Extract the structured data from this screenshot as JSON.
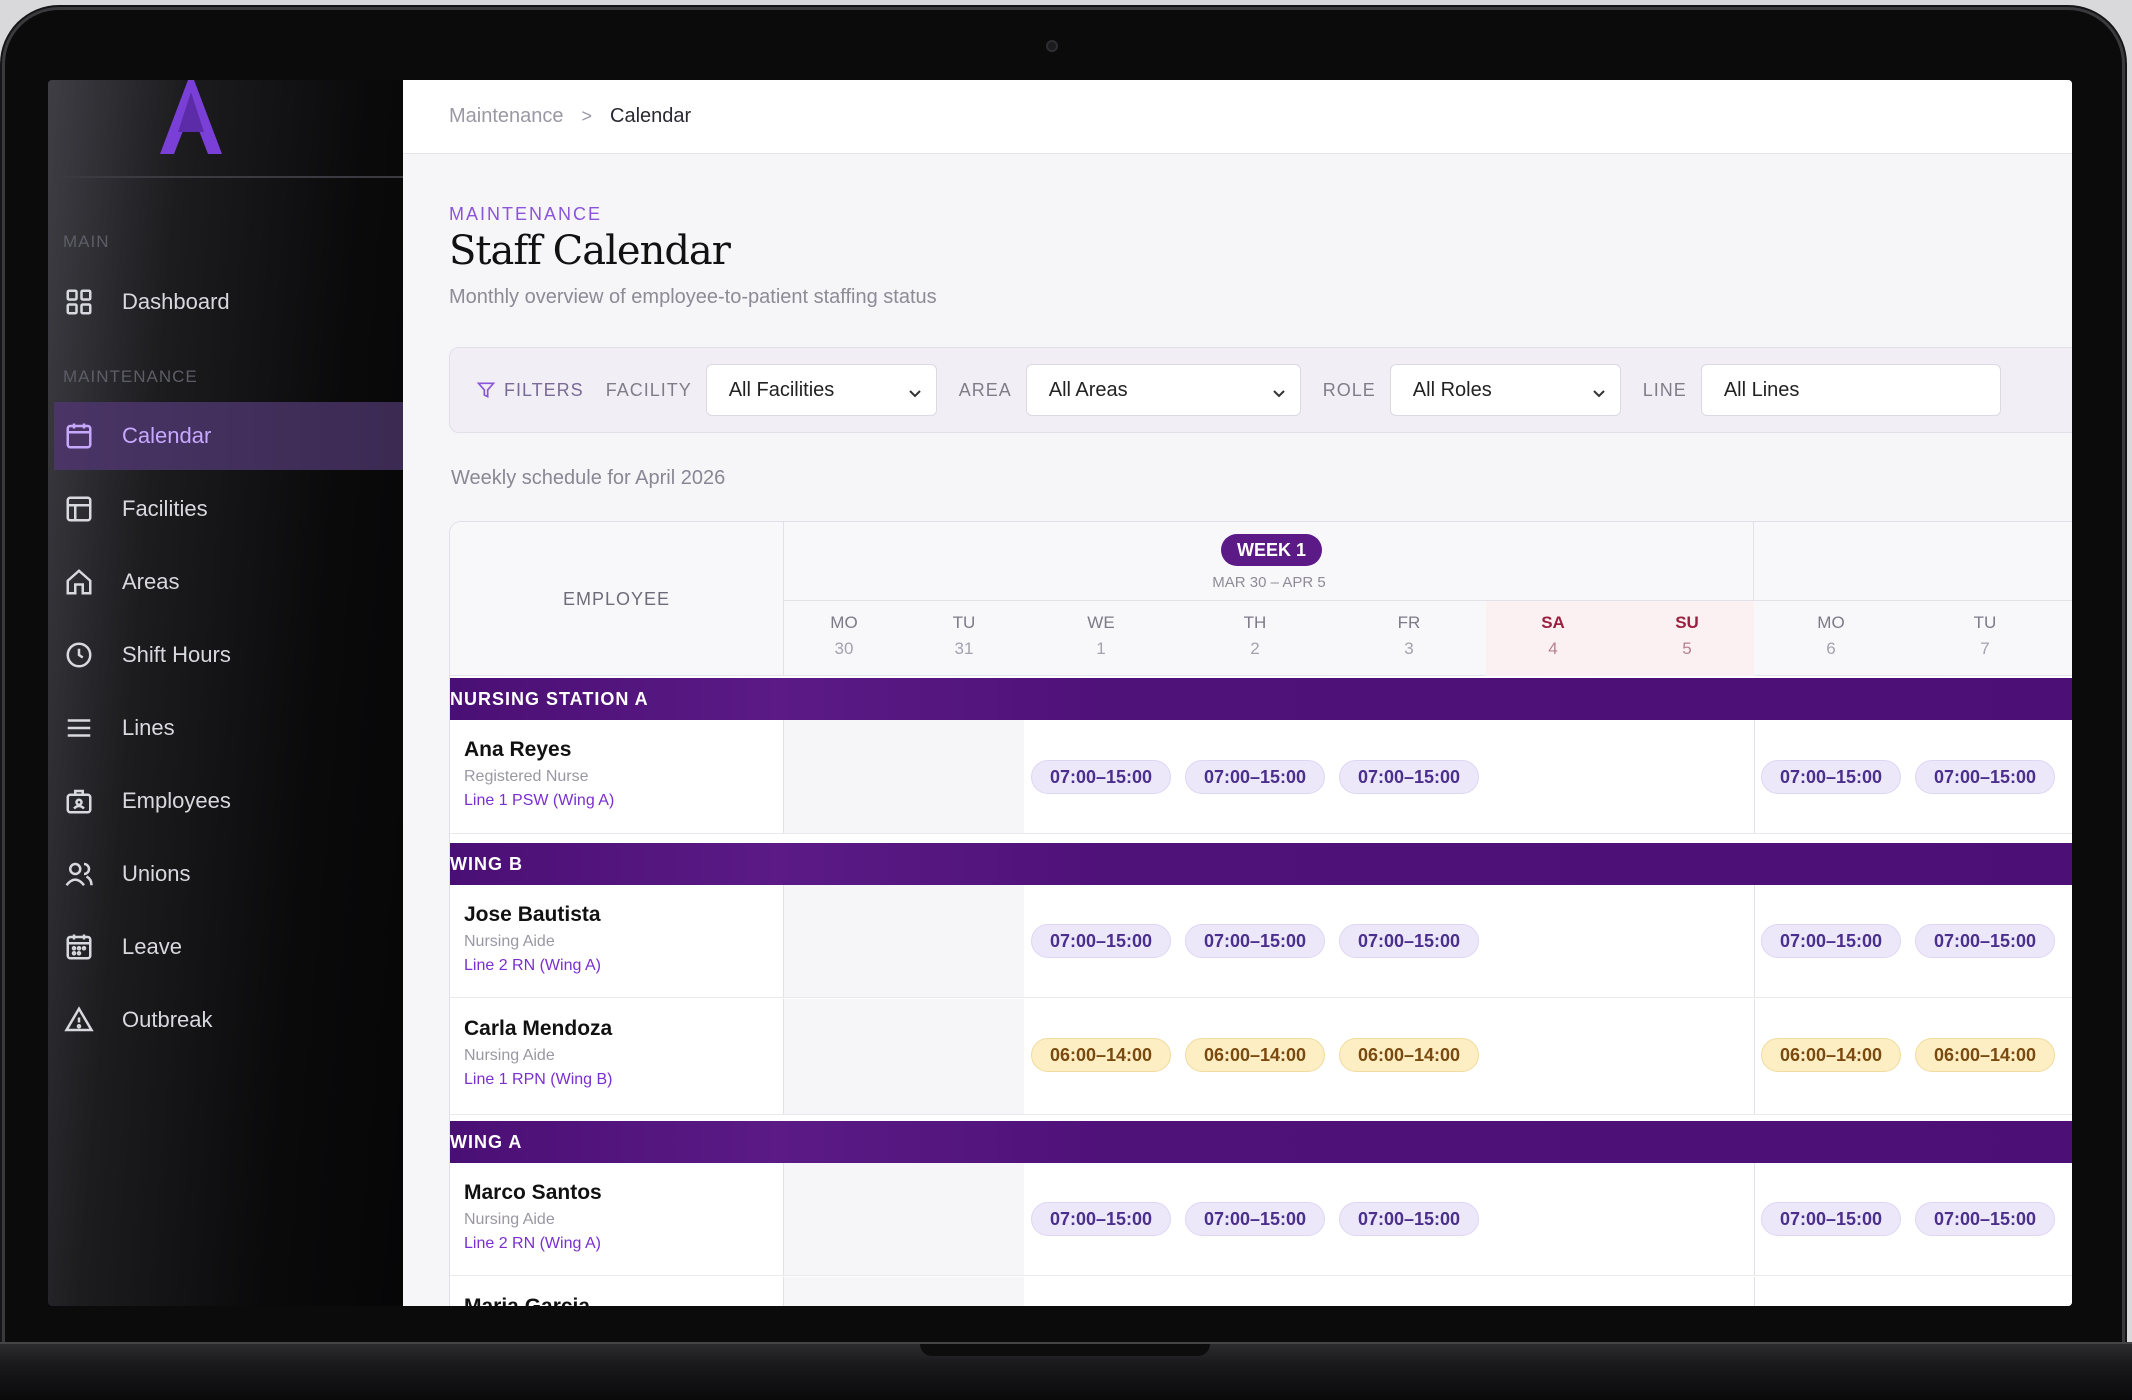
{
  "brand": {
    "logo_tagline": "",
    "accent": "#8a55d8"
  },
  "sidebar": {
    "section_main": "MAIN",
    "section_maintenance": "MAINTENANCE",
    "items": [
      {
        "label": "Dashboard",
        "icon": "grid-icon"
      },
      {
        "label": "Calendar",
        "icon": "calendar-icon",
        "active": true
      },
      {
        "label": "Facilities",
        "icon": "layout-icon"
      },
      {
        "label": "Areas",
        "icon": "home-icon"
      },
      {
        "label": "Shift Hours",
        "icon": "clock-icon"
      },
      {
        "label": "Lines",
        "icon": "menu-icon"
      },
      {
        "label": "Employees",
        "icon": "badge-icon"
      },
      {
        "label": "Unions",
        "icon": "users-icon"
      },
      {
        "label": "Leave",
        "icon": "calendar-days-icon"
      },
      {
        "label": "Outbreak",
        "icon": "alert-triangle-icon"
      }
    ]
  },
  "breadcrumb": {
    "parent": "Maintenance",
    "separator": ">",
    "current": "Calendar"
  },
  "header": {
    "eyebrow": "MAINTENANCE",
    "title": "Staff Calendar",
    "subtitle": "Monthly overview of employee-to-patient staffing status"
  },
  "filters": {
    "title": "FILTERS",
    "facility_label": "FACILITY",
    "facility_value": "All Facilities",
    "area_label": "AREA",
    "area_value": "All Areas",
    "role_label": "ROLE",
    "role_value": "All Roles",
    "line_label": "LINE",
    "line_value": "All Lines"
  },
  "schedule": {
    "caption": "Weekly schedule for April 2026",
    "employee_header": "EMPLOYEE",
    "week1": {
      "label": "WEEK 1",
      "range": "MAR 30 – APR 5"
    },
    "days": [
      {
        "dow": "MO",
        "num": "30"
      },
      {
        "dow": "TU",
        "num": "31"
      },
      {
        "dow": "WE",
        "num": "1"
      },
      {
        "dow": "TH",
        "num": "2"
      },
      {
        "dow": "FR",
        "num": "3"
      },
      {
        "dow": "SA",
        "num": "4",
        "weekend": true
      },
      {
        "dow": "SU",
        "num": "5",
        "weekend": true
      },
      {
        "dow": "MO",
        "num": "6"
      },
      {
        "dow": "TU",
        "num": "7"
      }
    ],
    "groups": [
      {
        "name": "NURSING STATION A",
        "rows": [
          {
            "name": "Ana Reyes",
            "role": "Registered Nurse",
            "line": "Line 1 PSW (Wing A)",
            "shift": "07:00–15:00",
            "tone": "lav"
          }
        ]
      },
      {
        "name": "WING B",
        "rows": [
          {
            "name": "Jose Bautista",
            "role": "Nursing Aide",
            "line": "Line 2 RN (Wing A)",
            "shift": "07:00–15:00",
            "tone": "lav"
          },
          {
            "name": "Carla Mendoza",
            "role": "Nursing Aide",
            "line": "Line 1 RPN (Wing B)",
            "shift": "06:00–14:00",
            "tone": "amb"
          }
        ]
      },
      {
        "name": "WING A",
        "rows": [
          {
            "name": "Marco Santos",
            "role": "Nursing Aide",
            "line": "Line 2 RN (Wing A)",
            "shift": "07:00–15:00",
            "tone": "lav"
          },
          {
            "name": "Maria Garcia",
            "role": "",
            "line": "",
            "shift": "",
            "tone": "lav"
          }
        ]
      }
    ]
  }
}
